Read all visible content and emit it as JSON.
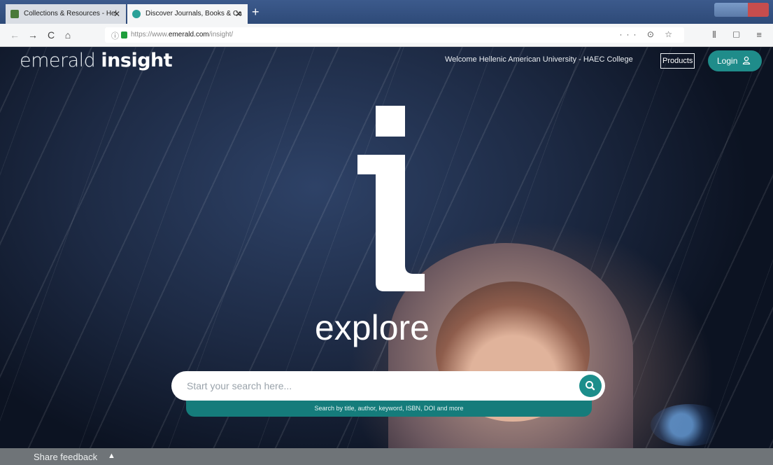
{
  "browser": {
    "tabs": [
      {
        "title": "Collections & Resources - Hel",
        "close": "✕",
        "favicon_color": "#4a7a3a"
      },
      {
        "title": "Discover Journals, Books & Ca",
        "close": "✕",
        "favicon_color": "#2aa198"
      }
    ],
    "new_tab": "+",
    "url_prefix": "https://www.",
    "url_domain": "emerald.com",
    "url_path": "/insight/",
    "url_actions": "··· ⊙ ☆",
    "nav": {
      "back": "←",
      "forward": "→",
      "reload": "C",
      "home": "⌂"
    },
    "toolbar_icons": "⫴ ▢ ≡"
  },
  "site": {
    "logo_light": "emerald ",
    "logo_bold": "insight",
    "welcome": "Welcome Hellenic American University - HAEC College",
    "products": "Products",
    "login": "Login"
  },
  "hero": {
    "explore": "explore",
    "search_placeholder": "Start your search here...",
    "search_hint": "Search by title, author, keyword, ISBN, DOI and more"
  },
  "footer": {
    "share_feedback": "Share feedback",
    "arrow": "▲"
  },
  "colors": {
    "accent": "#1c8e8b",
    "accent_dark": "#157c7b",
    "feedback_bar": "#6f7478"
  }
}
